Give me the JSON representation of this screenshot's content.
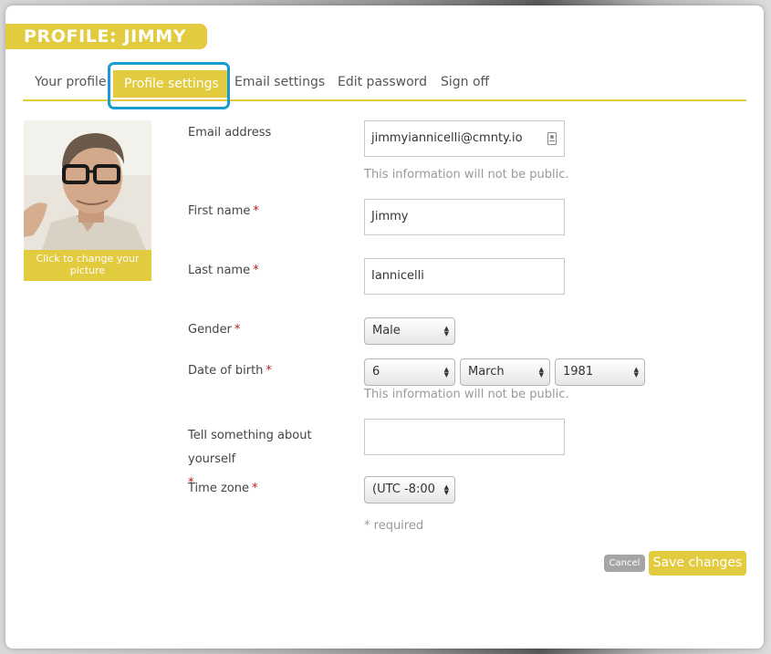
{
  "header": {
    "title": "PROFILE: JIMMY"
  },
  "tabs": [
    {
      "label": "Your profile"
    },
    {
      "label": "Profile settings",
      "active": true
    },
    {
      "label": "Email settings"
    },
    {
      "label": "Edit password"
    },
    {
      "label": "Sign off"
    }
  ],
  "avatar": {
    "caption": "Click to change your picture"
  },
  "form": {
    "email": {
      "label": "Email address",
      "value": "jimmyiannicelli@cmnty.io",
      "hint": "This information will not be public."
    },
    "first_name": {
      "label": "First name",
      "required_mark": "*",
      "value": "Jimmy"
    },
    "last_name": {
      "label": "Last name",
      "required_mark": "*",
      "value": "Iannicelli"
    },
    "gender": {
      "label": "Gender",
      "required_mark": "*",
      "value": "Male"
    },
    "dob": {
      "label": "Date of birth",
      "required_mark": "*",
      "day": "6",
      "month": "March",
      "year": "1981",
      "hint": "This information will not be public."
    },
    "about": {
      "label": "Tell something about yourself",
      "required_mark": "*",
      "value": ""
    },
    "timezone": {
      "label": "Time zone",
      "required_mark": "*",
      "value": "(UTC -8:00"
    },
    "required_note": "* required"
  },
  "actions": {
    "cancel_label": "Cancel",
    "save_label": "Save changes"
  },
  "colors": {
    "accent": "#e2cb3f",
    "focus_ring": "#1a9bcf",
    "required": "#b01d1d"
  }
}
